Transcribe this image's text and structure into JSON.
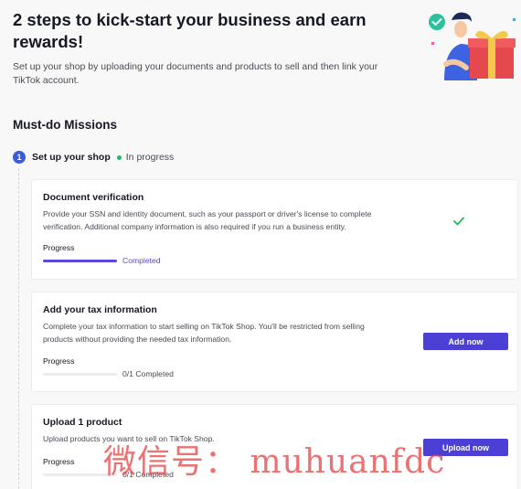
{
  "header": {
    "title": "2 steps to kick-start your business and earn rewards!",
    "subtitle": "Set up your shop by uploading your documents and products to sell and then link your TikTok account."
  },
  "missions": {
    "title": "Must-do Missions",
    "step": {
      "number": "1",
      "title": "Set up your shop",
      "status": "In progress",
      "status_color": "#25b864"
    }
  },
  "cards": [
    {
      "title": "Document verification",
      "description": "Provide your SSN and identity document, such as your passport or driver's license to complete verification. Additional company information is also required if you run a business entity.",
      "progress_label": "Progress",
      "progress_text": "Completed",
      "progress_fraction": 1.0,
      "state": "completed"
    },
    {
      "title": "Add your tax information",
      "description": "Complete your tax information to start selling on TikTok Shop. You'll be restricted from selling products without providing the needed tax information.",
      "progress_label": "Progress",
      "progress_text": "0/1 Completed",
      "progress_fraction": 0,
      "button_label": "Add now"
    },
    {
      "title": "Upload 1 product",
      "description": "Upload products you want to sell on TikTok Shop.",
      "progress_label": "Progress",
      "progress_text": "0/1 Completed",
      "progress_fraction": 0,
      "button_label": "Upload now"
    }
  ],
  "watermark": "微信号： muhuanfdc",
  "colors": {
    "accent": "#4b3fd6",
    "step": "#3b5bdb",
    "success": "#25b864"
  },
  "icons": [
    "check-icon",
    "illustration-person-gift"
  ]
}
